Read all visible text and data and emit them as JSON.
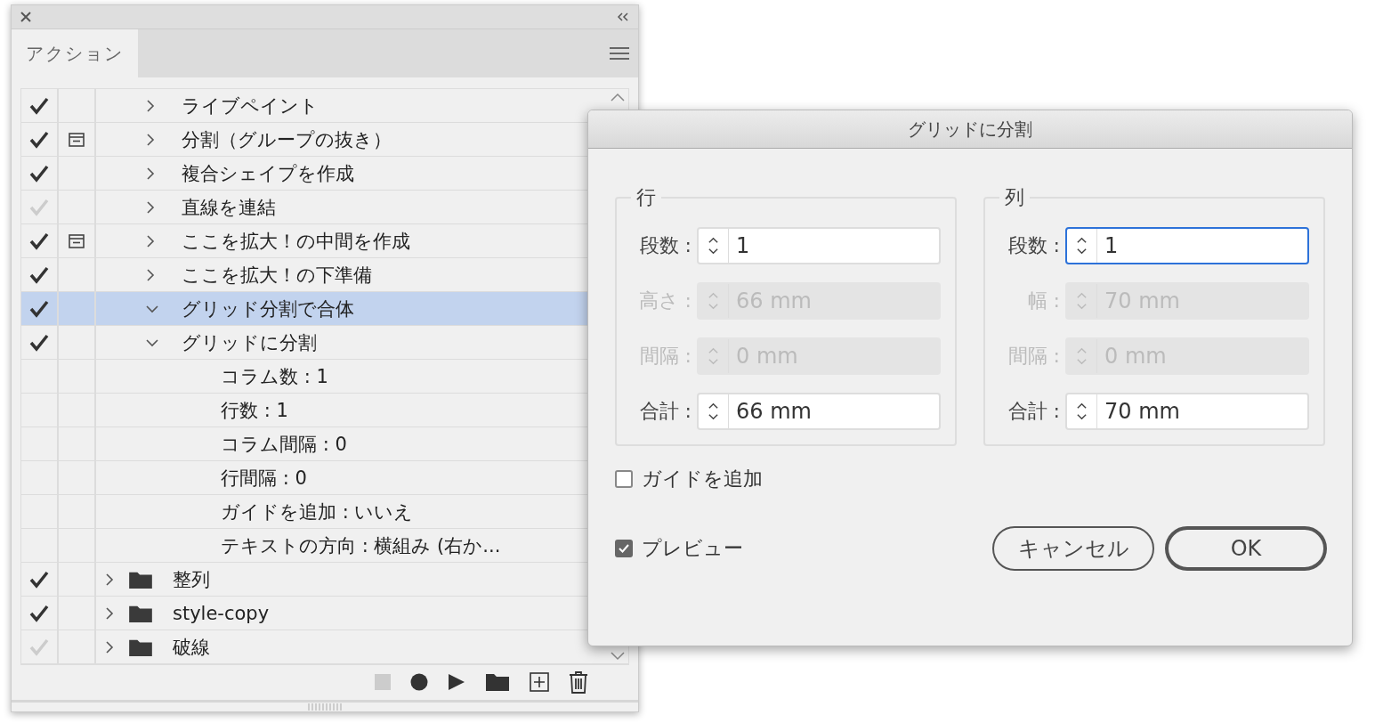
{
  "panel": {
    "tab": "アクション",
    "rows": [
      {
        "kind": "action",
        "checked": true,
        "dimmed": false,
        "dialog_toggle": false,
        "expanded": false,
        "selected": false,
        "text": "ライブペイント"
      },
      {
        "kind": "action",
        "checked": true,
        "dimmed": false,
        "dialog_toggle": true,
        "expanded": false,
        "selected": false,
        "text": "分割（グループの抜き）"
      },
      {
        "kind": "action",
        "checked": true,
        "dimmed": false,
        "dialog_toggle": false,
        "expanded": false,
        "selected": false,
        "text": "複合シェイプを作成"
      },
      {
        "kind": "action",
        "checked": true,
        "dimmed": true,
        "dialog_toggle": false,
        "expanded": false,
        "selected": false,
        "text": "直線を連結"
      },
      {
        "kind": "action",
        "checked": true,
        "dimmed": false,
        "dialog_toggle": true,
        "expanded": false,
        "selected": false,
        "text": "ここを拡大！の中間を作成"
      },
      {
        "kind": "action",
        "checked": true,
        "dimmed": false,
        "dialog_toggle": false,
        "expanded": false,
        "selected": false,
        "text": "ここを拡大！の下準備"
      },
      {
        "kind": "action",
        "checked": true,
        "dimmed": false,
        "dialog_toggle": false,
        "expanded": true,
        "selected": true,
        "text": "グリッド分割で合体",
        "children": [
          {
            "kind": "step",
            "checked": true,
            "dimmed": false,
            "dialog_toggle": false,
            "expanded": true,
            "selected": false,
            "text": "グリッドに分割",
            "children": [
              {
                "kind": "param",
                "selected": false,
                "text": "コラム数 : 1"
              },
              {
                "kind": "param",
                "selected": false,
                "text": "行数 : 1"
              },
              {
                "kind": "param",
                "selected": false,
                "text": "コラム間隔 : 0"
              },
              {
                "kind": "param",
                "selected": false,
                "text": "行間隔 : 0"
              },
              {
                "kind": "param",
                "selected": false,
                "text": "ガイドを追加 : いいえ"
              },
              {
                "kind": "param",
                "selected": false,
                "text": "テキストの方向 : 横組み (右か..."
              }
            ]
          }
        ]
      },
      {
        "kind": "set",
        "checked": true,
        "dimmed": false,
        "dialog_toggle": false,
        "expanded": false,
        "selected": false,
        "text": "整列"
      },
      {
        "kind": "set",
        "checked": true,
        "dimmed": false,
        "dialog_toggle": false,
        "expanded": false,
        "selected": false,
        "text": "style-copy"
      },
      {
        "kind": "set",
        "checked": true,
        "dimmed": true,
        "dialog_toggle": false,
        "expanded": false,
        "selected": false,
        "text": "破線"
      }
    ]
  },
  "dialog": {
    "title": "グリッドに分割",
    "groups": [
      {
        "legend": "行",
        "fields": [
          {
            "label": "段数 :",
            "value": "1",
            "disabled": false,
            "focused": false
          },
          {
            "label": "高さ :",
            "value": "66 mm",
            "disabled": true,
            "focused": false
          },
          {
            "label": "間隔 :",
            "value": "0 mm",
            "disabled": true,
            "focused": false
          },
          {
            "label": "合計 :",
            "value": "66 mm",
            "disabled": false,
            "focused": false
          }
        ]
      },
      {
        "legend": "列",
        "fields": [
          {
            "label": "段数 :",
            "value": "1",
            "disabled": false,
            "focused": true
          },
          {
            "label": "幅 :",
            "value": "70 mm",
            "disabled": true,
            "focused": false
          },
          {
            "label": "間隔 :",
            "value": "0 mm",
            "disabled": true,
            "focused": false
          },
          {
            "label": "合計 :",
            "value": "70 mm",
            "disabled": false,
            "focused": false
          }
        ]
      }
    ],
    "add_guides": {
      "label": "ガイドを追加",
      "checked": false
    },
    "preview": {
      "label": "プレビュー",
      "checked": true
    },
    "buttons": [
      {
        "label": "キャンセル",
        "default": false
      },
      {
        "label": "OK",
        "default": true
      }
    ]
  }
}
